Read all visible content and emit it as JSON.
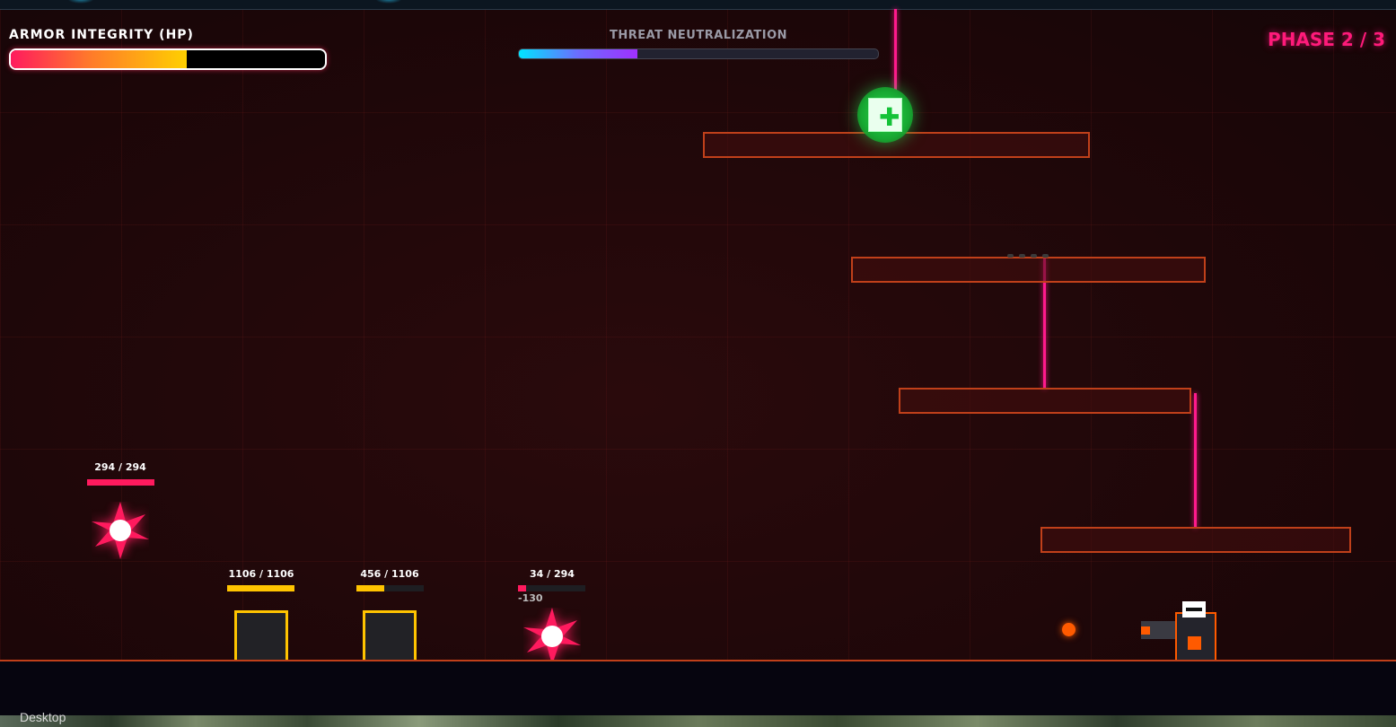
{
  "hud": {
    "armor_label": "ARMOR INTEGRITY (HP)",
    "armor_fraction": 0.56,
    "threat_label": "THREAT NEUTRALIZATION",
    "threat_fraction": 0.33,
    "phase_text": "PHASE 2 / 3"
  },
  "enemies": [
    {
      "type": "spike-drone",
      "hp_text": "294 / 294",
      "hp_fraction": 1.0,
      "bar_color": "#ff1a5e"
    },
    {
      "type": "block",
      "hp_text": "1106 / 1106",
      "hp_fraction": 1.0,
      "bar_color": "#ffc400"
    },
    {
      "type": "block",
      "hp_text": "456 / 1106",
      "hp_fraction": 0.41,
      "bar_color": "#ffc400"
    },
    {
      "type": "spike-drone",
      "hp_text": "34 / 294",
      "hp_fraction": 0.12,
      "bar_color": "#ff1a5e",
      "damage_text": "-130"
    }
  ],
  "pickups": [
    {
      "type": "health",
      "icon": "medical-cross-icon"
    }
  ],
  "colors": {
    "accent": "#ff1a7a",
    "platform_border": "#c0401a",
    "laser": "#ff1a8c",
    "player": "#ff5a00"
  },
  "taskbar": {
    "desktop_label": "Desktop"
  }
}
